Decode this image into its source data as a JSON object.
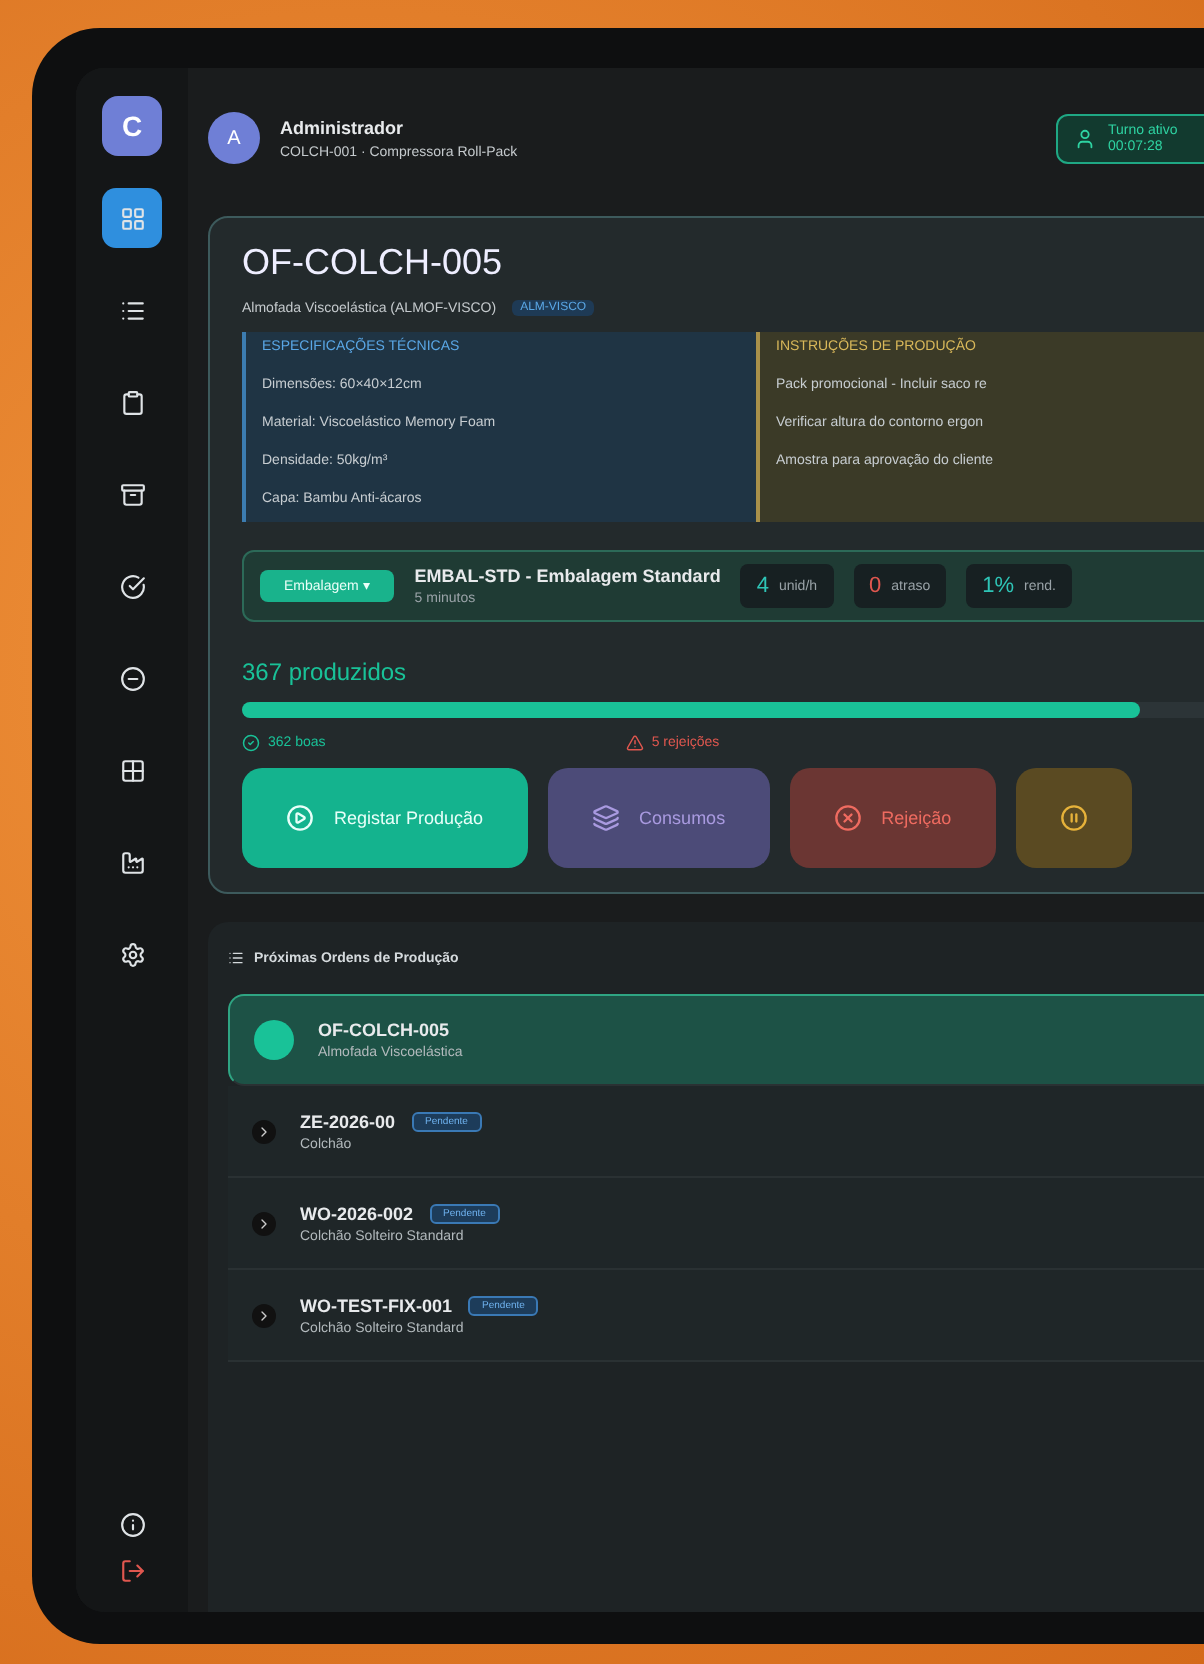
{
  "sidebar": {
    "logo": "C",
    "items": [
      {
        "selected": true
      },
      {
        "selected": false
      },
      {
        "selected": false
      },
      {
        "selected": false
      },
      {
        "selected": false
      },
      {
        "selected": false
      },
      {
        "selected": false
      },
      {
        "selected": false
      },
      {
        "selected": false
      }
    ]
  },
  "header": {
    "avatar": "A",
    "user": "Administrador",
    "station": "COLCH-001 · Compressora Roll-Pack",
    "shift": {
      "label": "Turno ativo",
      "time": "00:07:28"
    }
  },
  "order": {
    "code": "OF-COLCH-005",
    "product": "Almofada Viscoelástica (ALMOF-VISCO)",
    "tag": "ALM-VISCO",
    "specs": {
      "title": "ESPECIFICAÇÕES TÉCNICAS",
      "lines": [
        "Dimensões: 60×40×12cm",
        "Material: Viscoelástico Memory Foam",
        "Densidade: 50kg/m³",
        "Capa: Bambu Anti-ácaros"
      ]
    },
    "instructions": {
      "title": "INSTRUÇÕES DE PRODUÇÃO",
      "lines": [
        "Pack promocional - Incluir saco re",
        "Verificar altura do contorno ergon",
        "Amostra para aprovação do cliente"
      ]
    },
    "operation": {
      "button": "Embalagem ▾",
      "name": "EMBAL-STD - Embalagem Standard",
      "duration": "5 minutos"
    },
    "stats": [
      {
        "value": "4",
        "label": "unid/h",
        "color": "#2ec4b6"
      },
      {
        "value": "0",
        "label": "atraso",
        "color": "#e0574f"
      },
      {
        "value": "1%",
        "label": "rend.",
        "color": "#2ec4b6"
      }
    ],
    "produced": "367 produzidos",
    "level": 0.84,
    "good": "362 boas",
    "rejects": "5 rejeições",
    "actions": [
      {
        "kind": "primary",
        "label": "Registar Produção"
      },
      {
        "kind": "consumption",
        "label": "Consumos"
      },
      {
        "kind": "reject",
        "label": "Rejeição"
      },
      {
        "kind": "pause"
      }
    ]
  },
  "queue": {
    "title": "Próximas Ordens de Produção",
    "items": [
      {
        "code": "OF-COLCH-005",
        "product": "Almofada Viscoelástica",
        "selected": true
      },
      {
        "code": "ZE-2026-00",
        "product": "Colchão",
        "status": "Pendente",
        "selected": false
      },
      {
        "code": "WO-2026-002",
        "product": "Colchão Solteiro Standard",
        "status": "Pendente",
        "selected": false
      },
      {
        "code": "WO-TEST-FIX-001",
        "product": "Colchão Solteiro Standard",
        "status": "Pendente",
        "selected": false
      }
    ]
  }
}
